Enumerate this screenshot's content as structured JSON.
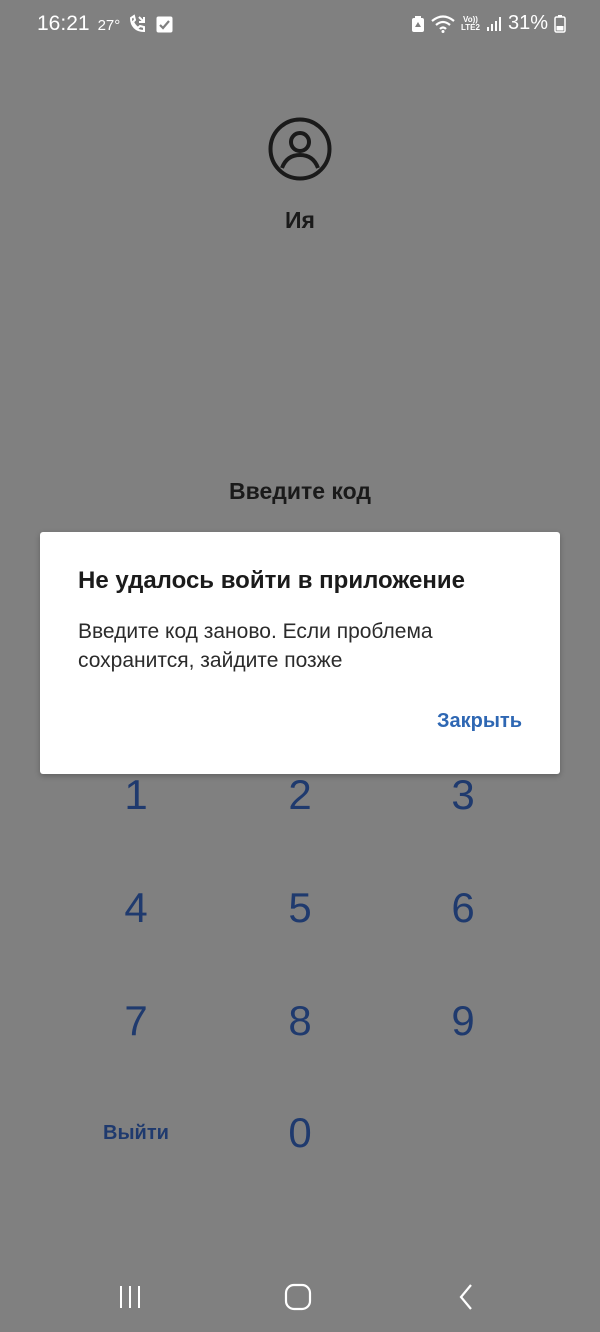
{
  "status_bar": {
    "time": "16:21",
    "temperature": "27°",
    "battery": "31%",
    "icons": [
      "weather-icon",
      "missed-call-icon",
      "checkbox-icon",
      "battery-saver-icon",
      "wifi-icon",
      "volte-icon",
      "signal-icon",
      "battery-icon"
    ],
    "volte_top": "Vo))",
    "volte_bottom": "LTE2"
  },
  "profile": {
    "icon": "user-circle-icon",
    "name": "Ия"
  },
  "prompt": "Введите код",
  "keypad": {
    "keys": [
      "1",
      "2",
      "3",
      "4",
      "5",
      "6",
      "7",
      "8",
      "9",
      "0"
    ],
    "logout_label": "Выйти"
  },
  "dialog": {
    "title": "Не удалось войти в приложение",
    "message": "Введите код заново. Если проблема сохранится, зайдите позже",
    "close_label": "Закрыть"
  },
  "navbar": {
    "icons": [
      "recent-apps-icon",
      "home-icon",
      "back-icon"
    ]
  },
  "colors": {
    "background": "#808080",
    "key_text": "#1f3a6e",
    "dialog_action": "#2e67b3"
  }
}
